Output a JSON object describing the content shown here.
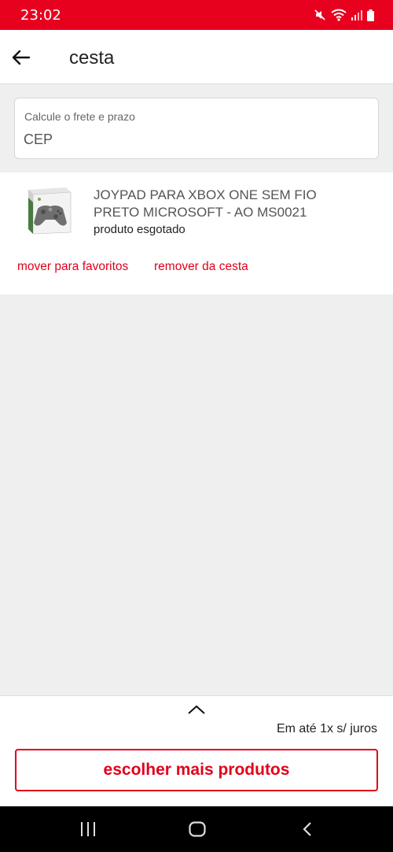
{
  "status_bar": {
    "time": "23:02",
    "icons": [
      "mute-icon",
      "wifi-icon",
      "signal-icon",
      "battery-icon"
    ],
    "background": "#e8001f"
  },
  "header": {
    "title": "cesta",
    "back_icon": "arrow-left-icon"
  },
  "shipping": {
    "label": "Calcule o frete e prazo",
    "placeholder": "CEP",
    "value": ""
  },
  "cart_item": {
    "image_icon": "controller-box-image",
    "name": "JOYPAD PARA XBOX ONE SEM FIO PRETO MICROSOFT - AO MS0021",
    "status": "produto esgotado",
    "actions": {
      "favorite": "mover para favoritos",
      "remove": "remover da cesta"
    }
  },
  "summary": {
    "expand_icon": "chevron-up-icon",
    "installments": "Em até 1x s/ juros",
    "cta": "escolher mais produtos"
  },
  "system_nav": {
    "buttons": [
      "recents-icon",
      "home-icon",
      "back-icon"
    ]
  },
  "colors": {
    "brand": "#e2001a",
    "page_background": "#efefef"
  }
}
